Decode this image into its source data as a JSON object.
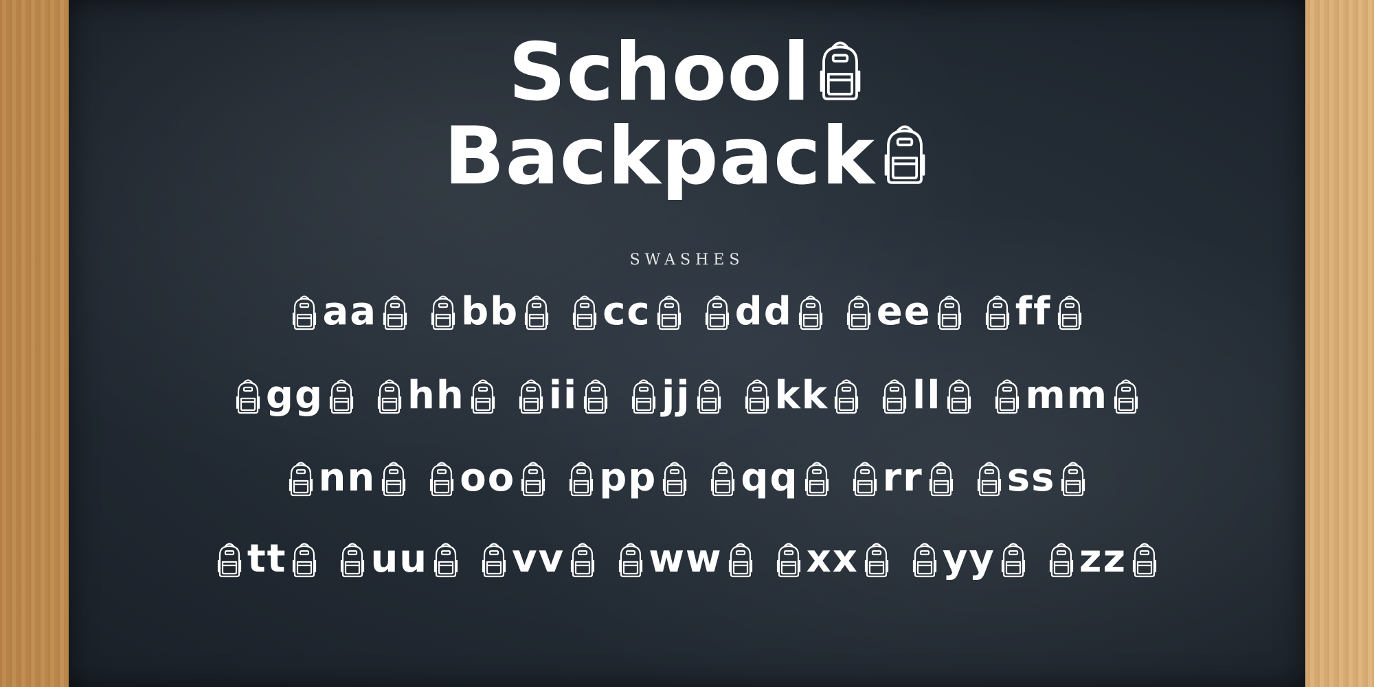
{
  "title": {
    "line1": "School",
    "line2": "Backpack"
  },
  "subtitle": "SWASHES",
  "glyph_rows": [
    [
      "aa",
      "bb",
      "cc",
      "dd",
      "ee",
      "ff"
    ],
    [
      "gg",
      "hh",
      "ii",
      "jj",
      "kk",
      "ll",
      "mm"
    ],
    [
      "nn",
      "oo",
      "pp",
      "qq",
      "rr",
      "ss"
    ],
    [
      "tt",
      "uu",
      "vv",
      "ww",
      "xx",
      "yy",
      "zz"
    ]
  ],
  "colors": {
    "board": "#222a33",
    "frame": "#c99a5e",
    "chalk": "#ffffff"
  },
  "icons": {
    "swash": "backpack-icon"
  }
}
